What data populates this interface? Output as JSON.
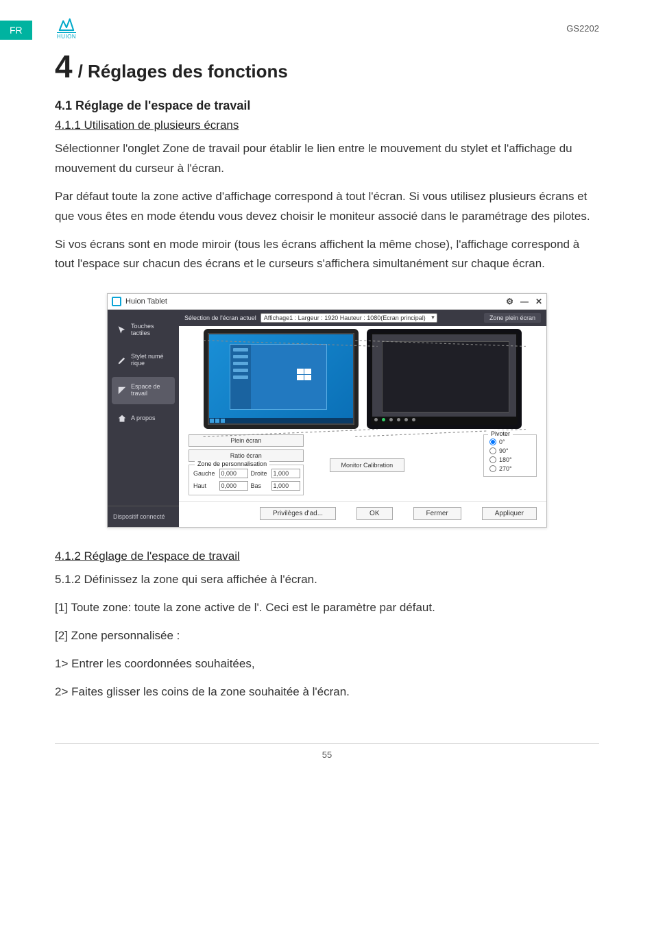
{
  "page": {
    "lang_tab": "FR",
    "logo_text": "HUION",
    "model": "GS2202",
    "page_number": "55"
  },
  "headings": {
    "section_number": "4",
    "section_title": "/ Réglages des fonctions",
    "h2_41": "4.1 Réglage de l'espace de travail",
    "h3_411": "4.1.1 Utilisation de plusieurs écrans",
    "h3_412": "4.1.2 Réglage de l'espace de travail"
  },
  "paragraphs": {
    "p1": "Sélectionner l'onglet Zone de travail pour établir le lien entre le mouvement du stylet et l'affichage du mouvement du curseur à l'écran.",
    "p2": "Par défaut toute la zone active d'affichage correspond à tout l'écran. Si vous utilisez plusieurs écrans et que vous êtes en mode étendu vous devez choisir le moniteur associé dans le paramétrage des pilotes.",
    "p3": "Si vos écrans sont en mode miroir (tous les écrans affichent la même chose), l'affichage correspond à tout l'espace sur chacun des écrans et le curseurs s'affichera simultanément sur chaque écran.",
    "p4": "5.1.2 Définissez la zone qui sera affichée à l'écran.",
    "p5": "[1] Toute zone: toute la zone active de l'. Ceci est le paramètre par défaut.",
    "p6": "[2] Zone personnalisée :",
    "p7": "1> Entrer les coordonnées souhaitées,",
    "p8": "2> Faites glisser les coins de la zone souhaitée à l'écran."
  },
  "app": {
    "title": "Huion Tablet",
    "controls": {
      "settings": "⚙",
      "min": "—",
      "close": "✕"
    },
    "sidebar": {
      "items": [
        {
          "label": "Touches tactiles"
        },
        {
          "label": "Stylet numé rique"
        },
        {
          "label": "Espace de travail"
        },
        {
          "label": "A propos"
        }
      ],
      "footer": "Dispositif connecté"
    },
    "toolbar": {
      "label": "Sélection de l'écran actuel",
      "select_value": "Affichage1 : Largeur : 1920  Hauteur : 1080(Ecran principal)",
      "fullzone": "Zone plein écran"
    },
    "buttons": {
      "full_screen": "Plein écran",
      "ratio": "Ratio écran",
      "custom_label": "Zone de personnalisation",
      "left_label": "Gauche",
      "left_val": "0,000",
      "right_label": "Droite",
      "right_val": "1,000",
      "top_label": "Haut",
      "top_val": "0,000",
      "bottom_label": "Bas",
      "bottom_val": "1,000",
      "calib": "Monitor Calibration"
    },
    "pivot": {
      "legend": "Pivoter",
      "o0": "0°",
      "o90": "90°",
      "o180": "180°",
      "o270": "270°"
    },
    "footer_buttons": {
      "priv": "Privilèges d'ad...",
      "ok": "OK",
      "close": "Fermer",
      "apply": "Appliquer"
    }
  }
}
